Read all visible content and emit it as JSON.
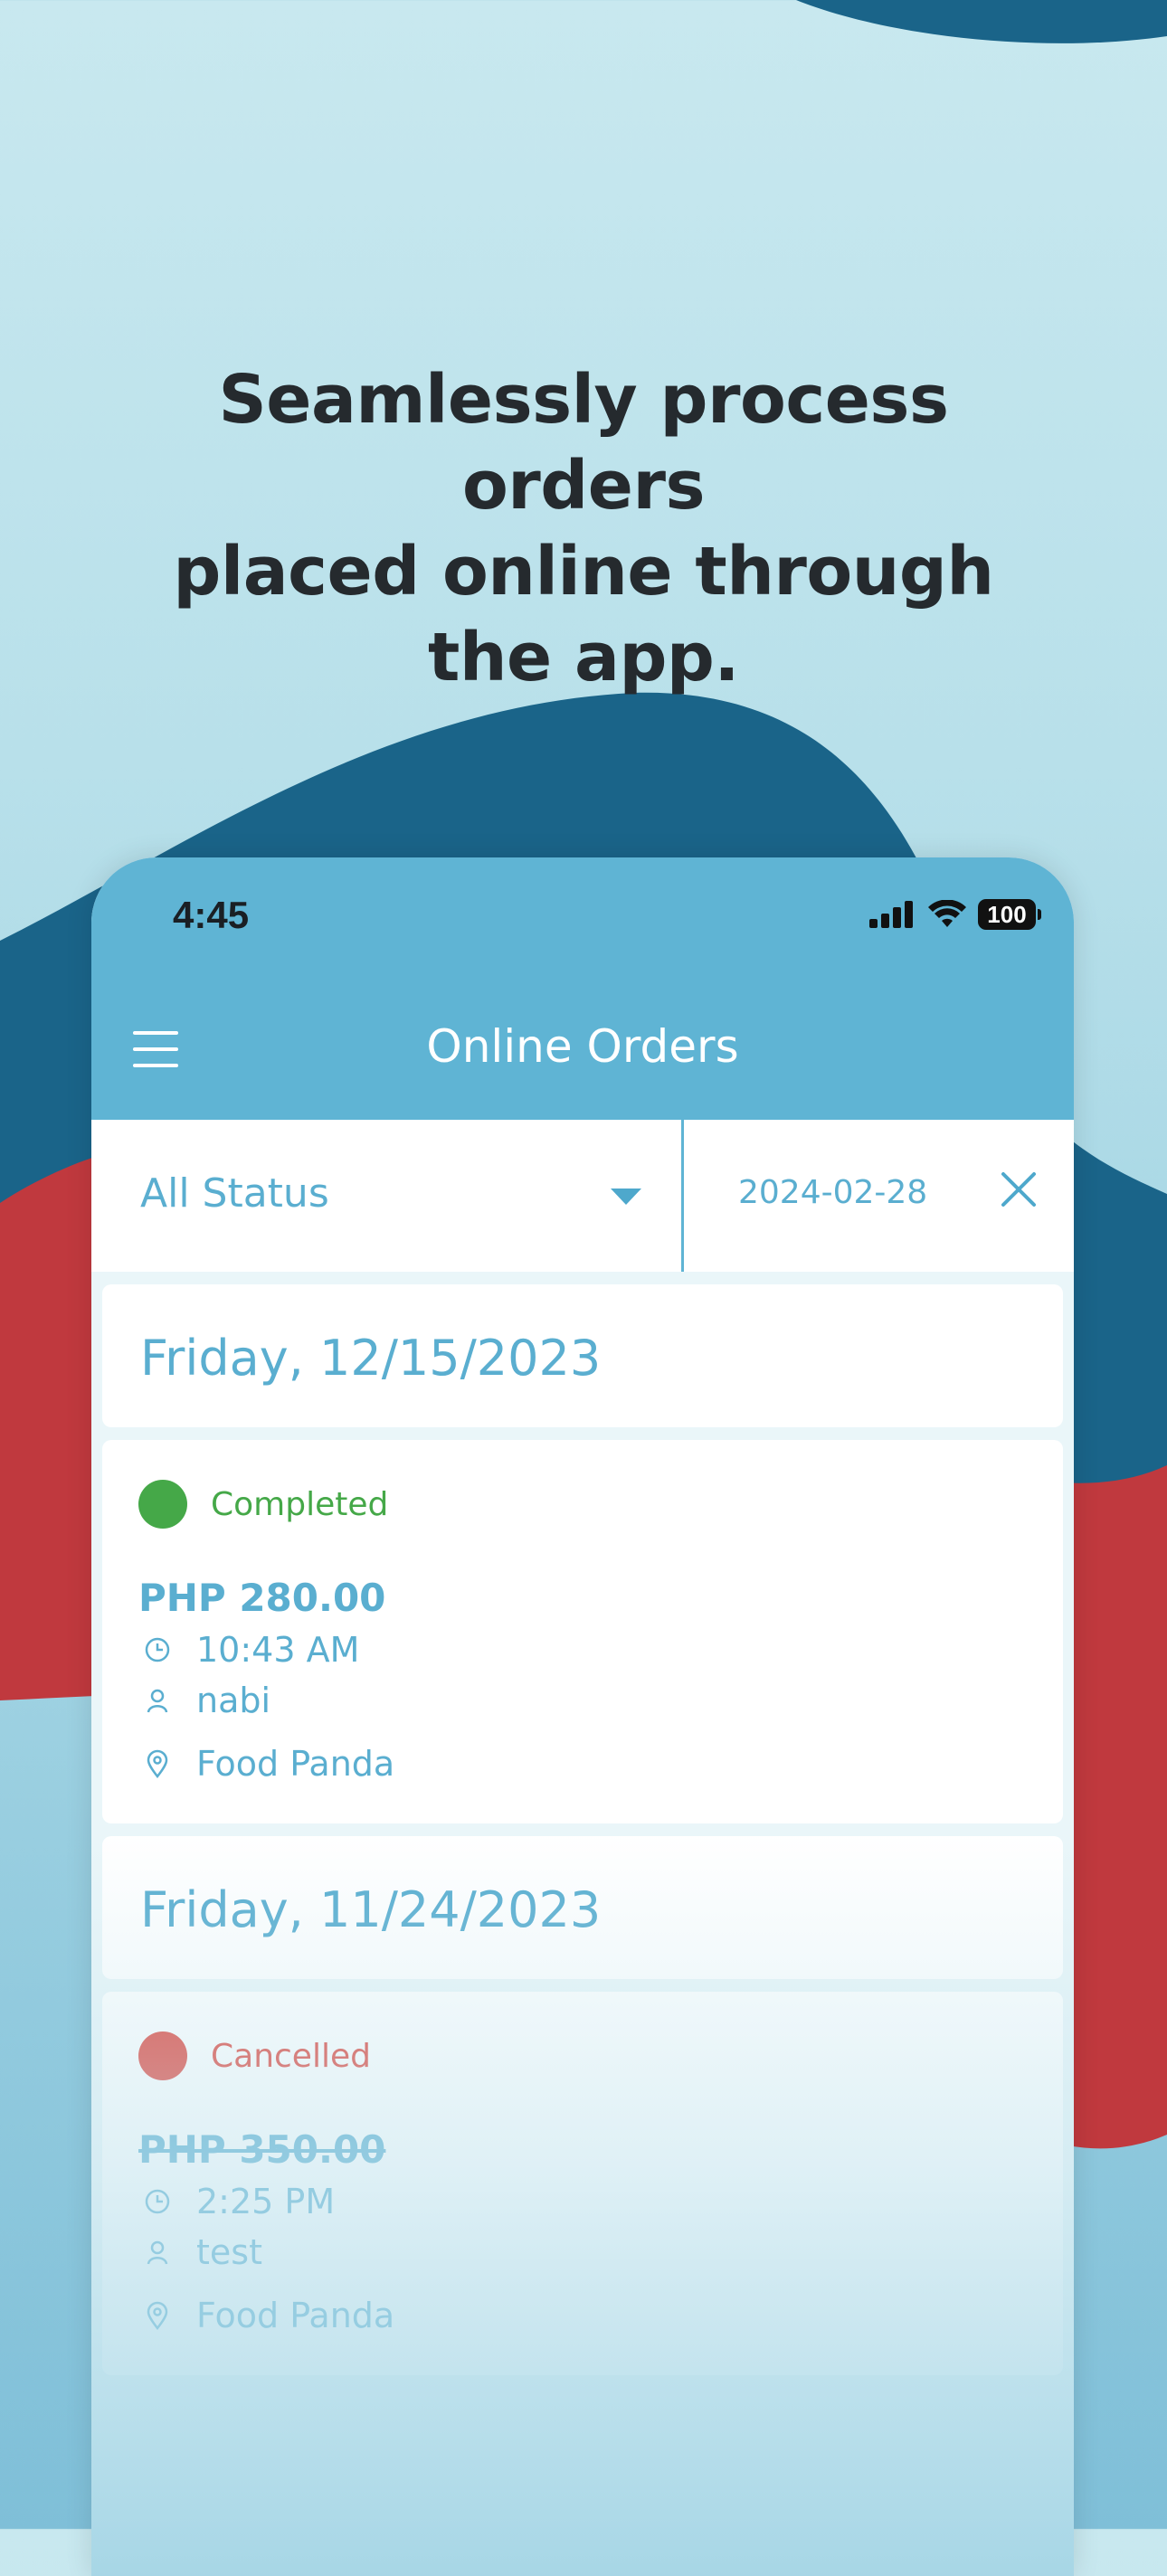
{
  "promo": {
    "headline_lines": [
      "Seamlessly process orders",
      "placed online through",
      "the app."
    ]
  },
  "status_bar": {
    "time": "4:45",
    "battery": "100"
  },
  "header": {
    "title": "Online Orders"
  },
  "filters": {
    "status_label": "All Status",
    "date": "2024-02-28"
  },
  "orders": [
    {
      "date_label": "Friday, 12/15/2023",
      "status": "Completed",
      "status_color": "#45a848",
      "amount": "PHP 280.00",
      "time": "10:43 AM",
      "customer": "nabi",
      "channel": "Food Panda"
    },
    {
      "date_label": "Friday, 11/24/2023",
      "status": "Cancelled",
      "status_color": "#e0483f",
      "amount": "PHP 350.00",
      "time": "2:25 PM",
      "customer": "test",
      "channel": "Food Panda"
    }
  ],
  "colors": {
    "accent": "#5fb4d4",
    "text_accent": "#5aaed0",
    "wave_dark_blue": "#1a6489",
    "wave_red": "#c0393e",
    "headline": "#252a2e"
  }
}
